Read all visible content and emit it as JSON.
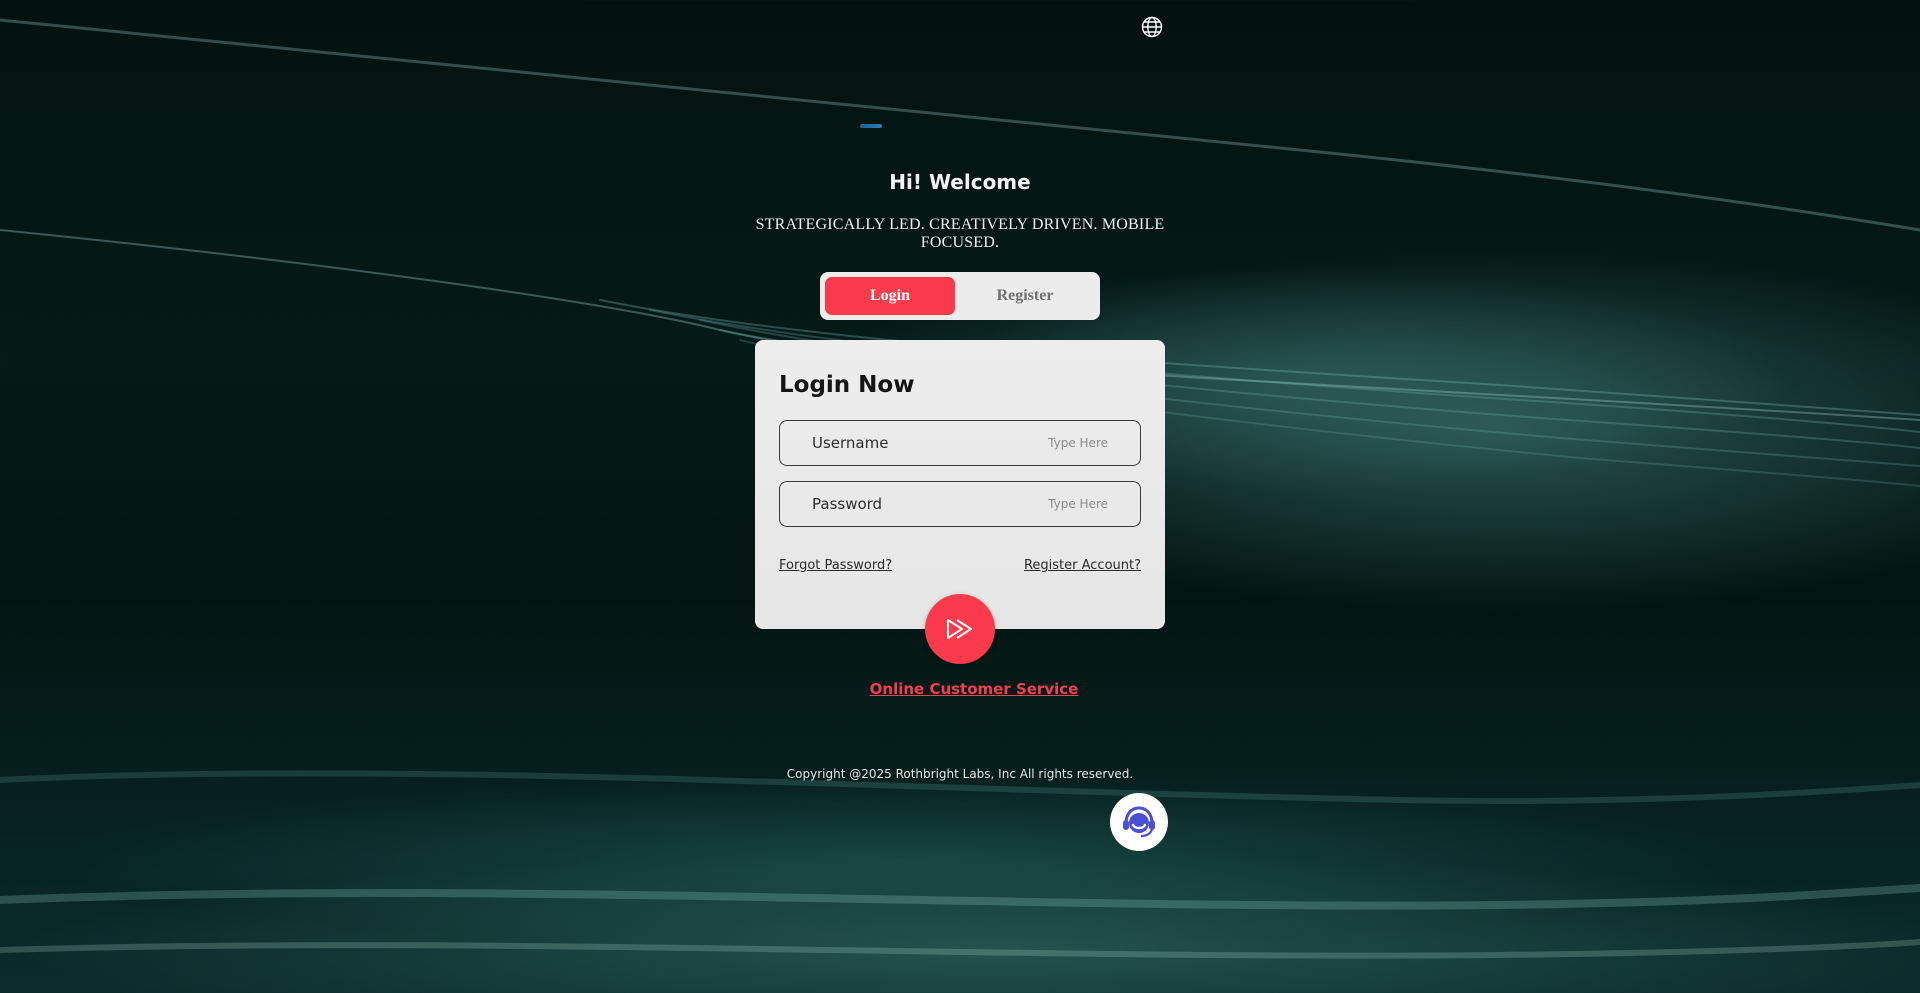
{
  "header": {
    "language_icon": "globe-icon",
    "logo_icon": "brand-logo"
  },
  "hero": {
    "greeting": "Hi! Welcome",
    "tagline": "STRATEGICALLY LED. CREATIVELY DRIVEN. MOBILE FOCUSED."
  },
  "tabs": [
    {
      "label": "Login",
      "active": true
    },
    {
      "label": "Register",
      "active": false
    }
  ],
  "form": {
    "title": "Login Now",
    "username": {
      "label": "Username",
      "placeholder": "Type Here",
      "value": ""
    },
    "password": {
      "label": "Password",
      "placeholder": "Type Here",
      "value": ""
    },
    "forgot_password_label": "Forgot Password?",
    "register_account_label": "Register Account?",
    "submit_icon": "double-play-arrow-icon"
  },
  "support": {
    "online_service_label": "Online Customer Service",
    "fab_icon": "headset-agent-icon"
  },
  "footer": {
    "copyright": "Copyright @2025 Rothbright Labs, Inc All rights reserved."
  },
  "colors": {
    "accent": "#fb3b4b",
    "card_bg": "#ececec",
    "background": "#031512"
  }
}
